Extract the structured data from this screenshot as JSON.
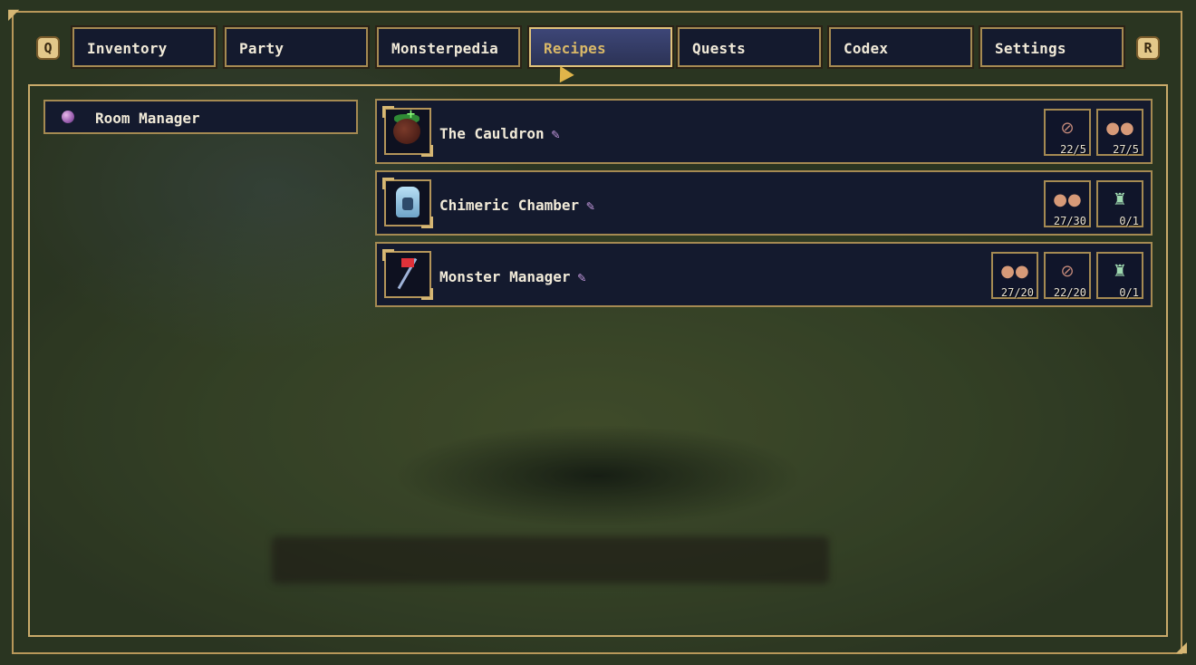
{
  "keys": {
    "left": "Q",
    "right": "R"
  },
  "tabs": [
    {
      "label": "Inventory",
      "active": false
    },
    {
      "label": "Party",
      "active": false
    },
    {
      "label": "Monsterpedia",
      "active": false
    },
    {
      "label": "Recipes",
      "active": true
    },
    {
      "label": "Quests",
      "active": false
    },
    {
      "label": "Codex",
      "active": false
    },
    {
      "label": "Settings",
      "active": false
    }
  ],
  "sidebar": {
    "items": [
      {
        "label": "Room Manager",
        "icon": "orb-icon"
      }
    ]
  },
  "recipes": [
    {
      "name": "The Cauldron",
      "icon": "cauldron-icon",
      "costs": [
        {
          "icon": "log-icon",
          "qty": "22/5"
        },
        {
          "icon": "stone-icon",
          "qty": "27/5"
        }
      ]
    },
    {
      "name": "Chimeric Chamber",
      "icon": "chimeric-chamber-icon",
      "costs": [
        {
          "icon": "stone-icon",
          "qty": "27/30"
        },
        {
          "icon": "potion-icon",
          "qty": "0/1"
        }
      ]
    },
    {
      "name": "Monster Manager",
      "icon": "monster-manager-icon",
      "costs": [
        {
          "icon": "stone-icon",
          "qty": "27/20"
        },
        {
          "icon": "log-icon",
          "qty": "22/20"
        },
        {
          "icon": "potion-icon",
          "qty": "0/1"
        }
      ]
    }
  ],
  "colors": {
    "panel": "#141a2e",
    "border_gold": "#a58a52",
    "active_tab_text": "#d9b868",
    "text": "#f1ead8"
  }
}
